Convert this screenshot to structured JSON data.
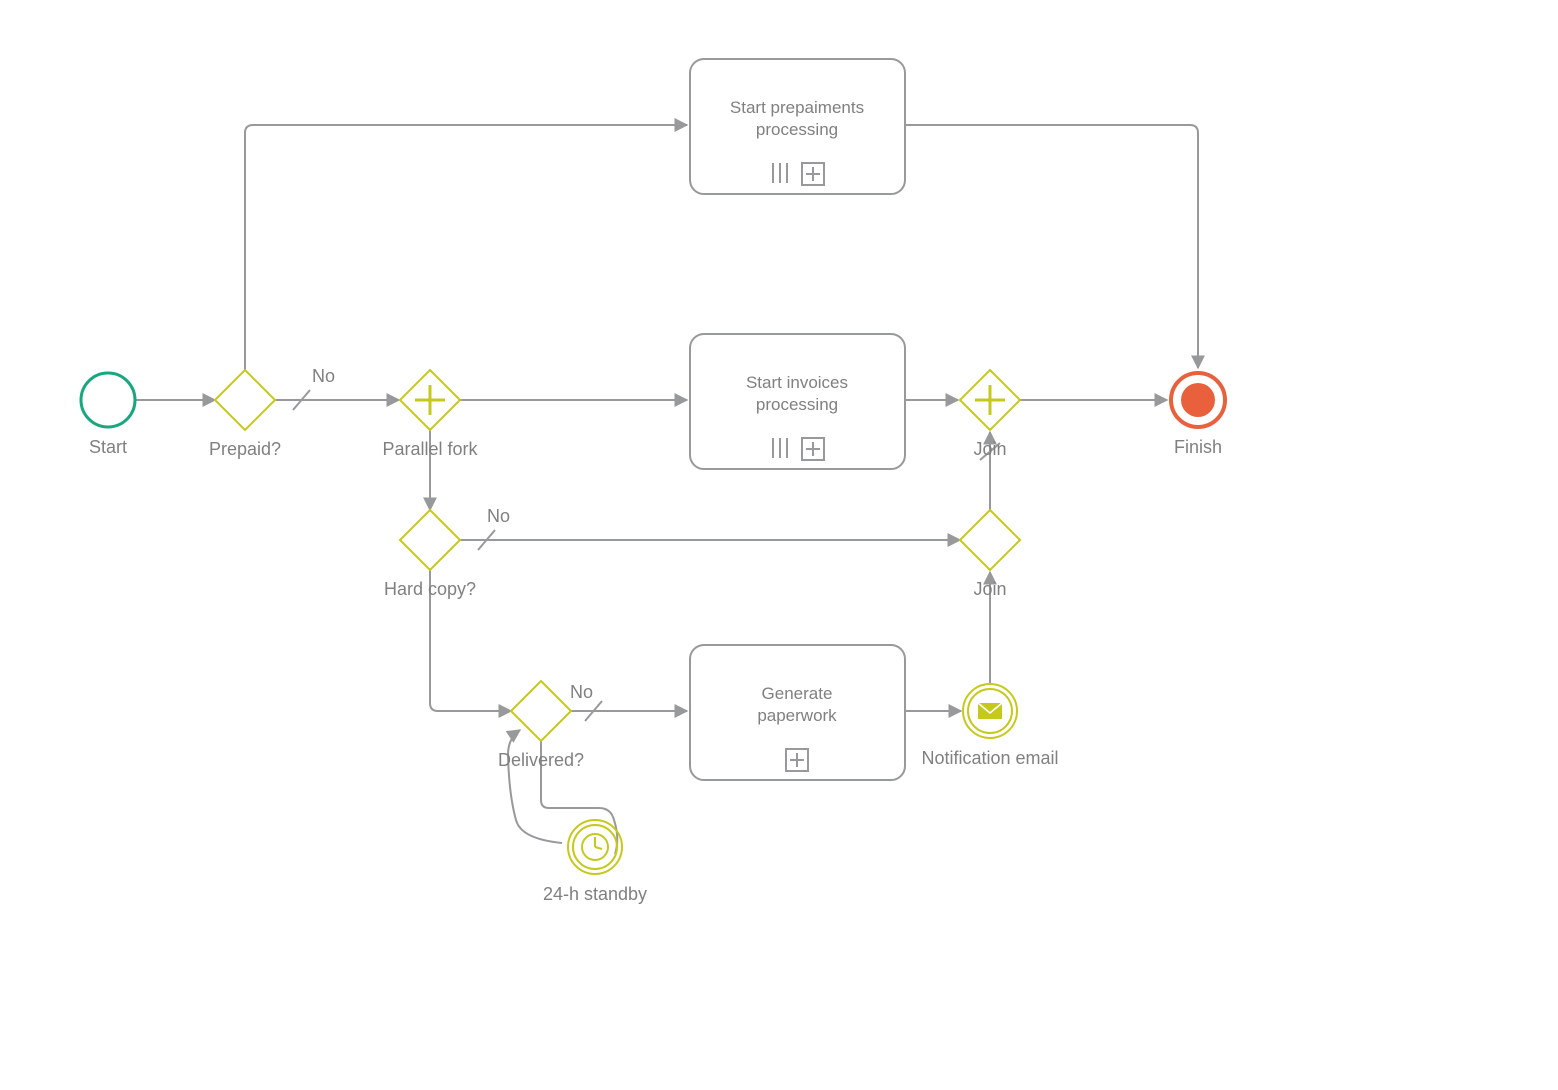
{
  "diagram": {
    "type": "BPMN",
    "start": {
      "label": "Start"
    },
    "finish": {
      "label": "Finish"
    },
    "gateways": {
      "prepaid": {
        "label": "Prepaid?",
        "no": "No"
      },
      "fork": {
        "label": "Parallel fork"
      },
      "hardcopy": {
        "label": "Hard copy?",
        "no": "No"
      },
      "delivered": {
        "label": "Delivered?",
        "no": "No"
      },
      "join1": {
        "label": "Join"
      },
      "join2": {
        "label": "Join"
      }
    },
    "tasks": {
      "prepay": {
        "label1": "Start prepaiments",
        "label2": "processing"
      },
      "invoices": {
        "label1": "Start invoices",
        "label2": "processing"
      },
      "paperwork": {
        "label1": "Generate",
        "label2": "paperwork"
      }
    },
    "events": {
      "standby": {
        "label": "24-h standby"
      },
      "email": {
        "label": "Notification email"
      }
    }
  },
  "colors": {
    "gray": "#97999b",
    "olive": "#c6c91c",
    "teal": "#1aa67f",
    "orange": "#e8613c"
  }
}
